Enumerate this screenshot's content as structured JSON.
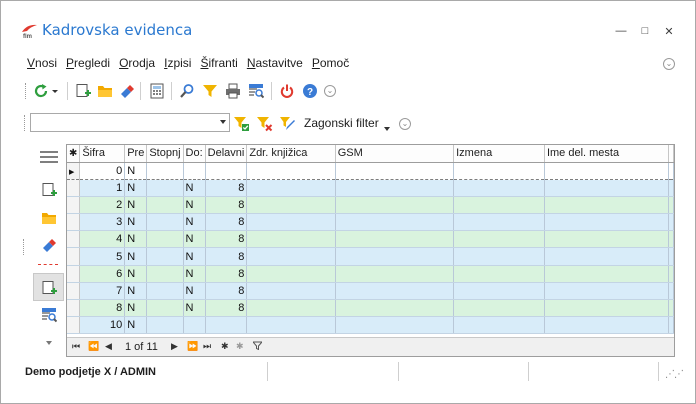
{
  "window": {
    "title": "Kadrovska evidenca",
    "minimize_glyph": "—",
    "maximize_glyph": "□",
    "close_glyph": "✕"
  },
  "menu": {
    "items": [
      {
        "label": "Vnosi",
        "underline_index": 0
      },
      {
        "label": "Pregledi",
        "underline_index": 0
      },
      {
        "label": "Orodja",
        "underline_index": 0
      },
      {
        "label": "Izpisi",
        "underline_index": 0
      },
      {
        "label": "Šifranti",
        "underline_index": 0
      },
      {
        "label": "Nastavitve",
        "underline_index": 0
      },
      {
        "label": "Pomoč",
        "underline_index": 0
      }
    ]
  },
  "filter": {
    "combo_value": "",
    "label": "Zagonski filter"
  },
  "grid": {
    "columns": [
      "Šifra",
      "Pre",
      "Stopnj",
      "Do:",
      "Delavni",
      "Zdr. knjižica",
      "GSM",
      "Izmena",
      "Ime del. mesta"
    ],
    "new_row": [
      "0",
      "N",
      "",
      "",
      "",
      "",
      "",
      "",
      ""
    ],
    "rows": [
      [
        "1",
        "N",
        "",
        "N",
        "8",
        "",
        "",
        "",
        ""
      ],
      [
        "2",
        "N",
        "",
        "N",
        "8",
        "",
        "",
        "",
        ""
      ],
      [
        "3",
        "N",
        "",
        "N",
        "8",
        "",
        "",
        "",
        ""
      ],
      [
        "4",
        "N",
        "",
        "N",
        "8",
        "",
        "",
        "",
        ""
      ],
      [
        "5",
        "N",
        "",
        "N",
        "8",
        "",
        "",
        "",
        ""
      ],
      [
        "6",
        "N",
        "",
        "N",
        "8",
        "",
        "",
        "",
        ""
      ],
      [
        "7",
        "N",
        "",
        "N",
        "8",
        "",
        "",
        "",
        ""
      ],
      [
        "8",
        "N",
        "",
        "N",
        "8",
        "",
        "",
        "",
        ""
      ],
      [
        "10",
        "N",
        "",
        "",
        "",
        "",
        "",
        "",
        ""
      ]
    ],
    "navigator": {
      "position_text": "1 of 11"
    }
  },
  "status": {
    "text": "Demo podjetje X / ADMIN"
  },
  "colors": {
    "title": "#2b79d0",
    "row_odd": "#d8ecf9",
    "row_even": "#d9f3de",
    "refresh": "#2e9e3e",
    "power": "#e03a2f",
    "help": "#3a7bd5",
    "filter": "#f0b400"
  }
}
